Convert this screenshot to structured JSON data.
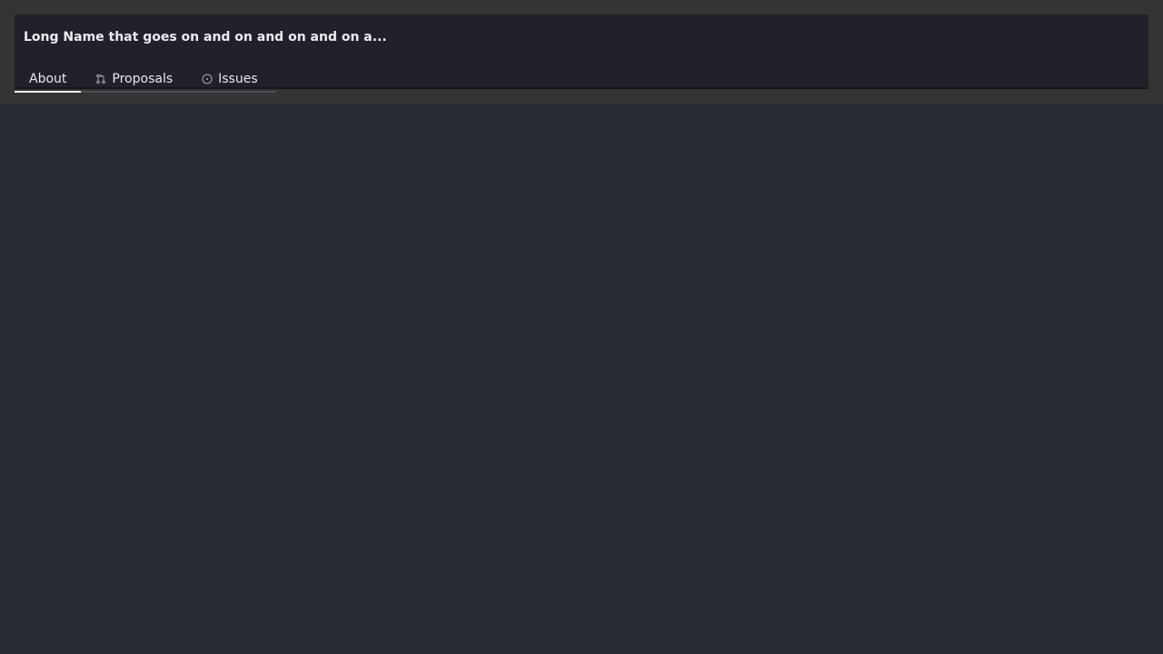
{
  "header": {
    "title": "Long Name that goes on and on and on and on a..."
  },
  "tabs": [
    {
      "label": "About",
      "icon": "",
      "active": true
    },
    {
      "label": "Proposals",
      "icon": "git-pull-request-icon",
      "active": false
    },
    {
      "label": "Issues",
      "icon": "issue-circle-icon",
      "active": false
    }
  ],
  "colors": {
    "page_background": "#282a36",
    "header_band": "#343434",
    "header_card": "#21212c",
    "active_tab_underline": "#f2f2f6",
    "text": "#ececf0"
  }
}
